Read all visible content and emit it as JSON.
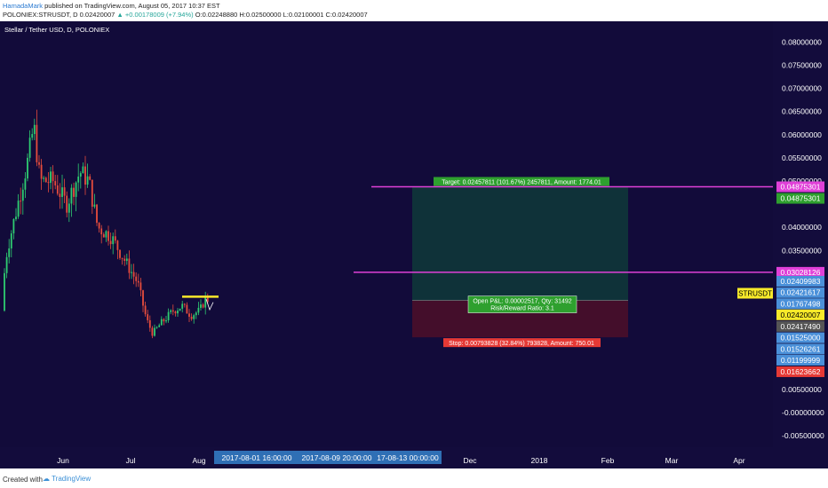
{
  "header": {
    "author": "HamadaMark",
    "published": "published on TradingView.com, August 05, 2017 10:37 EST",
    "symbol_line": "POLONIEX:STRUSDT, D  0.02420007",
    "change": "▲ +0.00178009 (+7.94%)",
    "ohlc": "O:0.02248880 H:0.02500000 L:0.02100001 C:0.02420007"
  },
  "footer": {
    "created_with": "Created with",
    "brand": "TradingView"
  },
  "chart_data": {
    "type": "candlestick",
    "title": "Stellar / Tether USD, D, POLONIEX",
    "ylim": [
      -0.0075,
      0.0845
    ],
    "y_ticks": [
      0.08,
      0.075,
      0.07,
      0.065,
      0.06,
      0.055,
      0.05,
      0.04,
      0.035,
      0.005,
      0.0,
      -0.005
    ],
    "y_tick_labels": [
      "0.08000000",
      "0.07500000",
      "0.07000000",
      "0.06500000",
      "0.06000000",
      "0.05500000",
      "0.05000000",
      "0.04000000",
      "0.03500000",
      "0.00500000",
      "-0.00000000",
      "-0.00500000"
    ],
    "x_ticks": [
      "Jun",
      "Jul",
      "Aug",
      "Dec",
      "2018",
      "Feb",
      "Mar",
      "Apr"
    ],
    "x_highlight_labels": [
      "2017-08-01 16:00:00",
      "2017-08-09 20:00:00",
      "17-08-13 00:00:00"
    ],
    "price_tags": [
      {
        "label": "0.04875301",
        "value": 0.04875301,
        "color": "#e040d8"
      },
      {
        "label": "0.04875301",
        "value": 0.04625,
        "color": "#2ea02e"
      },
      {
        "label": "0.03028126",
        "value": 0.03028126,
        "color": "#e040d8"
      },
      {
        "label": "0.02409983",
        "value": 0.02835,
        "color": "#4a90d9"
      },
      {
        "label": "0.02421617",
        "value": 0.0259,
        "color": "#4a90d9"
      },
      {
        "label": "0.01767498",
        "value": 0.0235,
        "color": "#4a90d9"
      },
      {
        "label": "0.02420007",
        "value": 0.0211,
        "color": "#f7e92a"
      },
      {
        "label": "0.02417490",
        "value": 0.0186,
        "color": "#555555"
      },
      {
        "label": "0.01525000",
        "value": 0.01615,
        "color": "#4a90d9"
      },
      {
        "label": "0.01526261",
        "value": 0.0137,
        "color": "#4a90d9"
      },
      {
        "label": "0.01199999",
        "value": 0.0113,
        "color": "#4a90d9"
      },
      {
        "label": "0.01623662",
        "value": 0.0088,
        "color": "#e53935"
      }
    ],
    "symbol_tag": "STRUSDT",
    "horizontal_lines": [
      {
        "value": 0.04875301,
        "color": "#e040d8"
      },
      {
        "value": 0.03028126,
        "color": "#e040d8"
      }
    ],
    "position": {
      "entry": 0.02420007,
      "target": 0.04875301,
      "stop": 0.01623662,
      "target_label": "Target: 0.02457811 (101.67%) 2457811, Amount: 1774.01",
      "stop_label": "Stop: 0.00793828 (32.84%) 793828, Amount: 750.01",
      "pnl_label": "Open P&L: 0.00002517, Qty: 31492",
      "rr_label": "Risk/Reward Ratio: 3.1"
    },
    "resistance_level": 0.025,
    "last_close": 0.02420007
  }
}
